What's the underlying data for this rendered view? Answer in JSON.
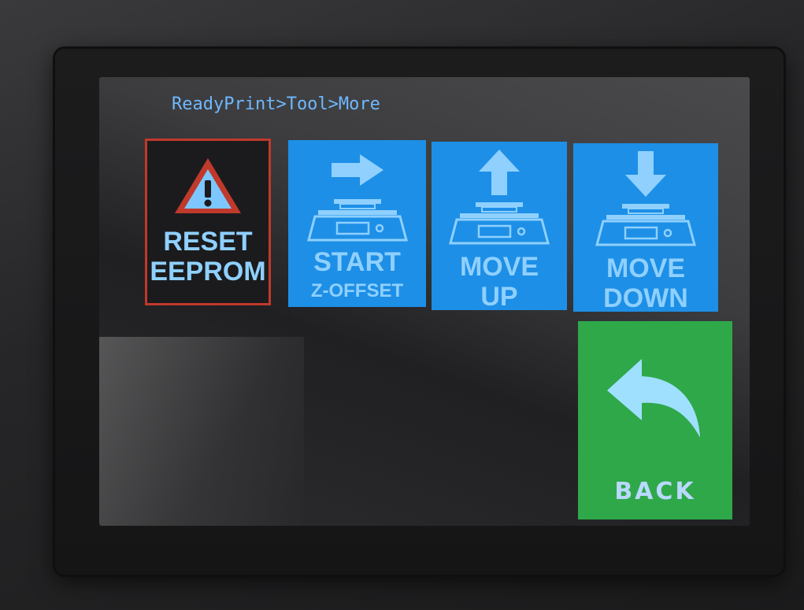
{
  "breadcrumb": "ReadyPrint>Tool>More",
  "tiles": {
    "reset": {
      "line1": "RESET",
      "line2": "EEPROM",
      "icon": "warning-icon"
    },
    "start": {
      "line1": "START",
      "line2": "Z-OFFSET",
      "icon": "arrow-right-icon"
    },
    "up": {
      "line1": "MOVE",
      "line2": "UP",
      "icon": "arrow-up-icon"
    },
    "down": {
      "line1": "MOVE",
      "line2": "DOWN",
      "icon": "arrow-down-icon"
    },
    "back": {
      "label": "BACK",
      "icon": "back-arrow-icon"
    }
  },
  "colors": {
    "tile_blue": "#1d8fe6",
    "tile_green": "#2fa84a",
    "reset_border": "#c0392b",
    "text_light_blue": "#8fd0ff",
    "breadcrumb_text": "#6fb8ff"
  }
}
